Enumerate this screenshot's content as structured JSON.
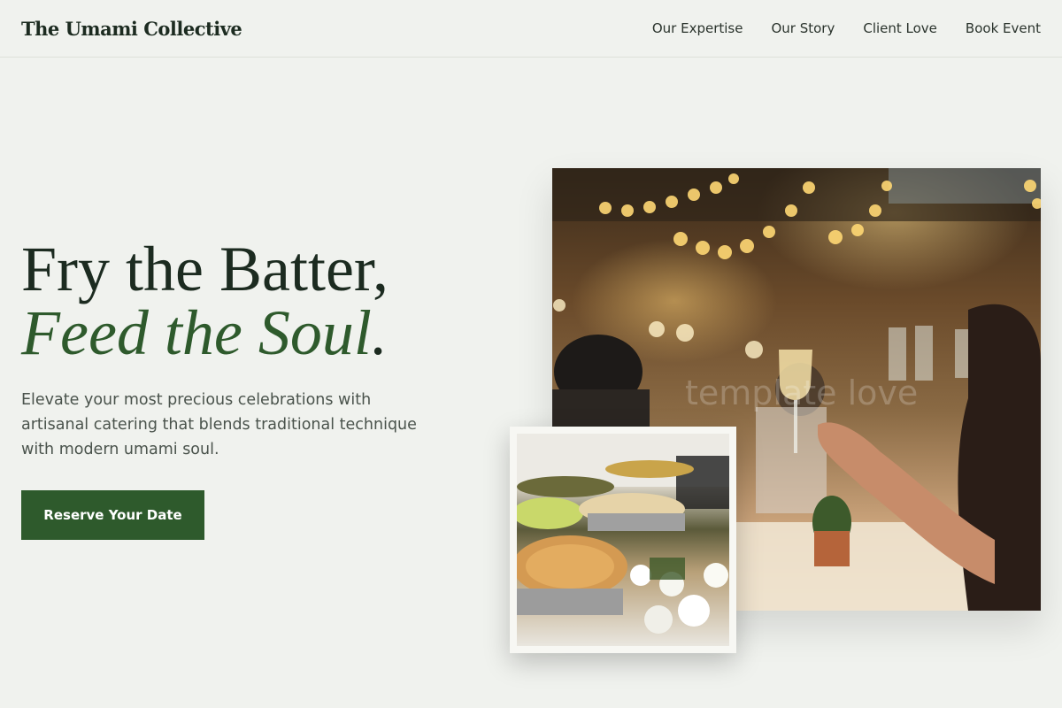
{
  "header": {
    "brand": "The Umami Collective",
    "nav": [
      "Our Expertise",
      "Our Story",
      "Client Love",
      "Book Event"
    ]
  },
  "hero": {
    "title_line1": "Fry the Batter,",
    "title_line2": "Feed the Soul",
    "title_period": ".",
    "description": "Elevate your most precious celebrations with artisanal catering that blends traditional technique with modern umami soul.",
    "cta_label": "Reserve Your Date"
  },
  "images": {
    "main_photo": "event-toast-photo",
    "main_watermark": "template love",
    "secondary_photo": "buffet-food-photo"
  },
  "colors": {
    "background": "#f0f2ee",
    "brand_green": "#2e5a2c",
    "heading": "#1c2b20",
    "body_text": "#4a534c"
  }
}
